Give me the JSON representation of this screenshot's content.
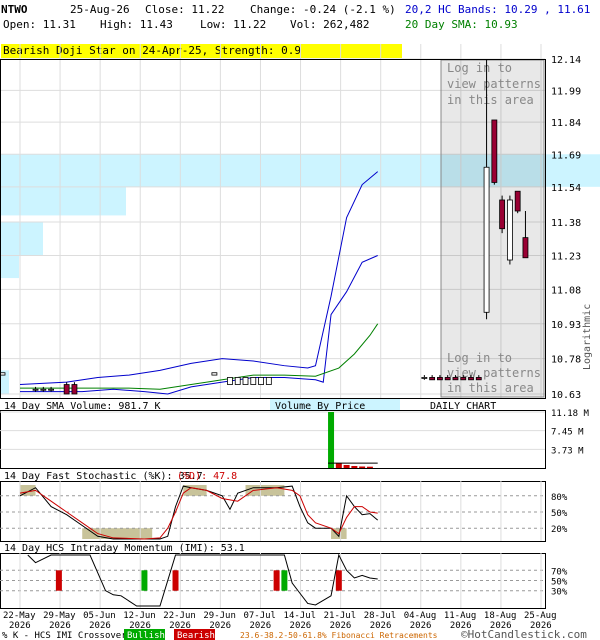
{
  "header": {
    "symbol": "NTWO",
    "date": "25-Aug-26",
    "close": "Close: 11.22",
    "change": "Change: -0.24 (-2.1 %)",
    "open": "Open: 11.31",
    "high": "High: 11.43",
    "low": "Low: 11.22",
    "vol": "Vol: 262,482",
    "bands": "20,2 HC Bands: 10.29 , 11.61",
    "sma": "20 Day SMA: 10.93"
  },
  "colors": {
    "bands": "#0000cc",
    "sma": "#008000",
    "bull": "#00aa00",
    "bear": "#cc0000",
    "candle_bear": "#990033",
    "vbp": "#ccf4ff",
    "banner": "#ffff00",
    "stoch_k": "#000000",
    "stoch_d": "#cc0000",
    "stoch_zone": "#c8c39a"
  },
  "chart_data": [
    {
      "type": "candlestick",
      "title": "Bearish Doji Star on 24-Apr-25, Strength: 0.9",
      "scale": "Logarithmic",
      "label": "DAILY CHART",
      "vbp_label": "Volume By Price",
      "overlay_text": [
        "Log in to",
        "view patterns",
        "in this area"
      ],
      "ylim": [
        10.63,
        12.14
      ],
      "y_ticks": [
        12.14,
        11.99,
        11.84,
        11.69,
        11.54,
        11.38,
        11.23,
        11.08,
        10.93,
        10.78,
        10.63
      ],
      "x_ticks": [
        "22-May\n2026",
        "29-May\n2026",
        "05-Jun\n2026",
        "12-Jun\n2026",
        "22-Jun\n2026",
        "29-Jun\n2026",
        "07-Jul\n2026",
        "14-Jul\n2026",
        "21-Jul\n2026",
        "28-Jul\n2026",
        "04-Aug\n2026",
        "11-Aug\n2026",
        "18-Aug\n2026",
        "25-Aug\n2026"
      ],
      "x_tick_dates": [
        "2026-05-22",
        "2026-05-29",
        "2026-06-05",
        "2026-06-12",
        "2026-06-22",
        "2026-06-29",
        "2026-07-07",
        "2026-07-14",
        "2026-07-21",
        "2026-07-28",
        "2026-08-04",
        "2026-08-11",
        "2026-08-18",
        "2026-08-25"
      ],
      "candles": [
        {
          "date": "2026-05-26",
          "o": 10.65,
          "h": 10.66,
          "l": 10.64,
          "c": 10.65
        },
        {
          "date": "2026-05-27",
          "o": 10.65,
          "h": 10.66,
          "l": 10.64,
          "c": 10.65
        },
        {
          "date": "2026-05-28",
          "o": 10.65,
          "h": 10.66,
          "l": 10.64,
          "c": 10.65
        },
        {
          "date": "2026-06-01",
          "o": 10.67,
          "h": 10.68,
          "l": 10.63,
          "c": 10.63
        },
        {
          "date": "2026-06-02",
          "o": 10.67,
          "h": 10.68,
          "l": 10.63,
          "c": 10.63
        },
        {
          "date": "2026-06-26",
          "o": 10.71,
          "h": 10.72,
          "l": 10.71,
          "c": 10.72
        },
        {
          "date": "2026-06-27",
          "o": 10.71,
          "h": 10.72,
          "l": 10.71,
          "c": 10.72
        },
        {
          "date": "2026-06-30",
          "o": 10.67,
          "h": 10.7,
          "l": 10.67,
          "c": 10.7
        },
        {
          "date": "2026-07-01",
          "o": 10.67,
          "h": 10.7,
          "l": 10.67,
          "c": 10.7
        },
        {
          "date": "2026-07-02",
          "o": 10.67,
          "h": 10.7,
          "l": 10.67,
          "c": 10.7
        },
        {
          "date": "2026-07-03",
          "o": 10.67,
          "h": 10.7,
          "l": 10.67,
          "c": 10.7
        },
        {
          "date": "2026-07-06",
          "o": 10.67,
          "h": 10.7,
          "l": 10.67,
          "c": 10.7
        },
        {
          "date": "2026-07-07",
          "o": 10.67,
          "h": 10.7,
          "l": 10.67,
          "c": 10.7
        },
        {
          "date": "2026-08-04",
          "o": 10.7,
          "h": 10.71,
          "l": 10.69,
          "c": 10.7
        },
        {
          "date": "2026-08-05",
          "o": 10.7,
          "h": 10.71,
          "l": 10.69,
          "c": 10.69
        },
        {
          "date": "2026-08-06",
          "o": 10.7,
          "h": 10.71,
          "l": 10.69,
          "c": 10.69
        },
        {
          "date": "2026-08-07",
          "o": 10.7,
          "h": 10.71,
          "l": 10.69,
          "c": 10.69
        },
        {
          "date": "2026-08-10",
          "o": 10.7,
          "h": 10.71,
          "l": 10.69,
          "c": 10.69
        },
        {
          "date": "2026-08-11",
          "o": 10.7,
          "h": 10.71,
          "l": 10.69,
          "c": 10.69
        },
        {
          "date": "2026-08-12",
          "o": 10.7,
          "h": 10.71,
          "l": 10.69,
          "c": 10.69
        },
        {
          "date": "2026-08-13",
          "o": 10.7,
          "h": 10.71,
          "l": 10.69,
          "c": 10.69
        },
        {
          "date": "2026-08-14",
          "o": 10.98,
          "h": 12.14,
          "l": 10.95,
          "c": 11.63
        },
        {
          "date": "2026-08-17",
          "o": 11.85,
          "h": 11.85,
          "l": 11.55,
          "c": 11.56
        },
        {
          "date": "2026-08-18",
          "o": 11.48,
          "h": 11.5,
          "l": 11.33,
          "c": 11.35
        },
        {
          "date": "2026-08-19",
          "o": 11.21,
          "h": 11.5,
          "l": 11.19,
          "c": 11.48
        },
        {
          "date": "2026-08-20",
          "o": 11.52,
          "h": 11.52,
          "l": 11.42,
          "c": 11.43
        },
        {
          "date": "2026-08-21",
          "o": 11.31,
          "h": 11.43,
          "l": 11.22,
          "c": 11.22
        }
      ],
      "bands_upper": [
        [
          0,
          10.67
        ],
        [
          6,
          10.68
        ],
        [
          10,
          10.7
        ],
        [
          14,
          10.71
        ],
        [
          18,
          10.73
        ],
        [
          22,
          10.76
        ],
        [
          26,
          10.78
        ],
        [
          30,
          10.77
        ],
        [
          34,
          10.75
        ],
        [
          37,
          10.74
        ],
        [
          38,
          10.75
        ],
        [
          40,
          11.05
        ],
        [
          42,
          11.4
        ],
        [
          44,
          11.55
        ],
        [
          46,
          11.61
        ]
      ],
      "bands_lower": [
        [
          0,
          10.64
        ],
        [
          8,
          10.64
        ],
        [
          12,
          10.65
        ],
        [
          16,
          10.64
        ],
        [
          19,
          10.63
        ],
        [
          22,
          10.66
        ],
        [
          26,
          10.68
        ],
        [
          30,
          10.7
        ],
        [
          34,
          10.7
        ],
        [
          38,
          10.69
        ],
        [
          39,
          10.68
        ],
        [
          40,
          10.97
        ],
        [
          42,
          11.07
        ],
        [
          44,
          11.2
        ],
        [
          46,
          11.23
        ]
      ],
      "sma_line": [
        [
          0,
          10.655
        ],
        [
          8,
          10.655
        ],
        [
          14,
          10.655
        ],
        [
          18,
          10.65
        ],
        [
          22,
          10.67
        ],
        [
          26,
          10.69
        ],
        [
          30,
          10.71
        ],
        [
          34,
          10.71
        ],
        [
          38,
          10.705
        ],
        [
          41,
          10.74
        ],
        [
          43,
          10.8
        ],
        [
          45,
          10.88
        ],
        [
          46,
          10.93
        ]
      ]
    },
    {
      "type": "bar",
      "title": "14 Day SMA Volume: 981.7 K",
      "y_ticks": [
        "11.18 M",
        "7.45 M",
        "3.73 M"
      ],
      "ylim": [
        0,
        11.18
      ],
      "bars": [
        {
          "i": 40,
          "v": 11.18,
          "color": "bull"
        },
        {
          "i": 41,
          "v": 0.9,
          "color": "bear"
        },
        {
          "i": 42,
          "v": 0.6,
          "color": "bear"
        },
        {
          "i": 43,
          "v": 0.4,
          "color": "bear"
        },
        {
          "i": 44,
          "v": 0.3,
          "color": "bear"
        },
        {
          "i": 45,
          "v": 0.26,
          "color": "bear"
        }
      ],
      "sma_level": 0.98
    },
    {
      "type": "line",
      "title": "14 Day Fast Stochastic (%K): 35.7",
      "title_d": "(%D): 47.8",
      "y_ticks": [
        "80%",
        "50%",
        "20%"
      ],
      "ylim": [
        0,
        100
      ],
      "k": [
        [
          0,
          80
        ],
        [
          2,
          95
        ],
        [
          4,
          60
        ],
        [
          6,
          45
        ],
        [
          8,
          25
        ],
        [
          10,
          5
        ],
        [
          12,
          0
        ],
        [
          14,
          0
        ],
        [
          16,
          0
        ],
        [
          18,
          0
        ],
        [
          19,
          5
        ],
        [
          20,
          60
        ],
        [
          21,
          98
        ],
        [
          22,
          95
        ],
        [
          24,
          90
        ],
        [
          26,
          80
        ],
        [
          27,
          55
        ],
        [
          28,
          85
        ],
        [
          30,
          95
        ],
        [
          33,
          95
        ],
        [
          35,
          98
        ],
        [
          36,
          60
        ],
        [
          37,
          30
        ],
        [
          38,
          20
        ],
        [
          40,
          20
        ],
        [
          41,
          5
        ],
        [
          42,
          80
        ],
        [
          43,
          60
        ],
        [
          44,
          45
        ],
        [
          45,
          47
        ],
        [
          46,
          35
        ]
      ],
      "d": [
        [
          0,
          85
        ],
        [
          2,
          90
        ],
        [
          4,
          70
        ],
        [
          6,
          50
        ],
        [
          8,
          30
        ],
        [
          10,
          10
        ],
        [
          12,
          2
        ],
        [
          16,
          0
        ],
        [
          18,
          2
        ],
        [
          19,
          20
        ],
        [
          20,
          50
        ],
        [
          21,
          85
        ],
        [
          22,
          95
        ],
        [
          24,
          90
        ],
        [
          26,
          75
        ],
        [
          28,
          70
        ],
        [
          30,
          90
        ],
        [
          33,
          95
        ],
        [
          35,
          90
        ],
        [
          36,
          80
        ],
        [
          37,
          45
        ],
        [
          38,
          30
        ],
        [
          40,
          20
        ],
        [
          41,
          10
        ],
        [
          42,
          40
        ],
        [
          43,
          60
        ],
        [
          44,
          60
        ],
        [
          45,
          50
        ],
        [
          46,
          48
        ]
      ],
      "zones": [
        [
          0,
          2,
          "high"
        ],
        [
          8,
          17,
          "low"
        ],
        [
          21,
          24,
          "high"
        ],
        [
          29,
          34,
          "high"
        ],
        [
          40,
          42,
          "low"
        ]
      ]
    },
    {
      "type": "line",
      "title": "14 Day HCS Intraday Momentum (IMI): 53.1",
      "y_ticks": [
        "70%",
        "50%",
        "30%"
      ],
      "ylim": [
        0,
        100
      ],
      "imi": [
        [
          1,
          100
        ],
        [
          2,
          85
        ],
        [
          4,
          100
        ],
        [
          6,
          100
        ],
        [
          7,
          100
        ],
        [
          8,
          100
        ],
        [
          9,
          100
        ],
        [
          10,
          65
        ],
        [
          11,
          30
        ],
        [
          12,
          22
        ],
        [
          13,
          20
        ],
        [
          14,
          10
        ],
        [
          15,
          0
        ],
        [
          16,
          0
        ],
        [
          18,
          0
        ],
        [
          20,
          100
        ],
        [
          21,
          100
        ],
        [
          22,
          100
        ],
        [
          24,
          100
        ],
        [
          26,
          100
        ],
        [
          28,
          100
        ],
        [
          30,
          100
        ],
        [
          33,
          100
        ],
        [
          34,
          100
        ],
        [
          35,
          45
        ],
        [
          36,
          25
        ],
        [
          37,
          5
        ],
        [
          38,
          2
        ],
        [
          40,
          20
        ],
        [
          41,
          100
        ],
        [
          42,
          70
        ],
        [
          43,
          55
        ],
        [
          44,
          60
        ],
        [
          45,
          55
        ],
        [
          46,
          53
        ]
      ],
      "signals": [
        [
          5,
          "bear"
        ],
        [
          16,
          "bull"
        ],
        [
          20,
          "bear"
        ],
        [
          33,
          "bear"
        ],
        [
          34,
          "bull"
        ],
        [
          41,
          "bear"
        ]
      ]
    }
  ],
  "footer": {
    "legend_prefix": "% K - HCS IMI Crossover:",
    "bullish": "Bullish",
    "bearish": "Bearish",
    "fib": "23.6-38.2-50-61.8% Fibonacci Retracements",
    "copyright": "©HotCandlestick.com"
  }
}
